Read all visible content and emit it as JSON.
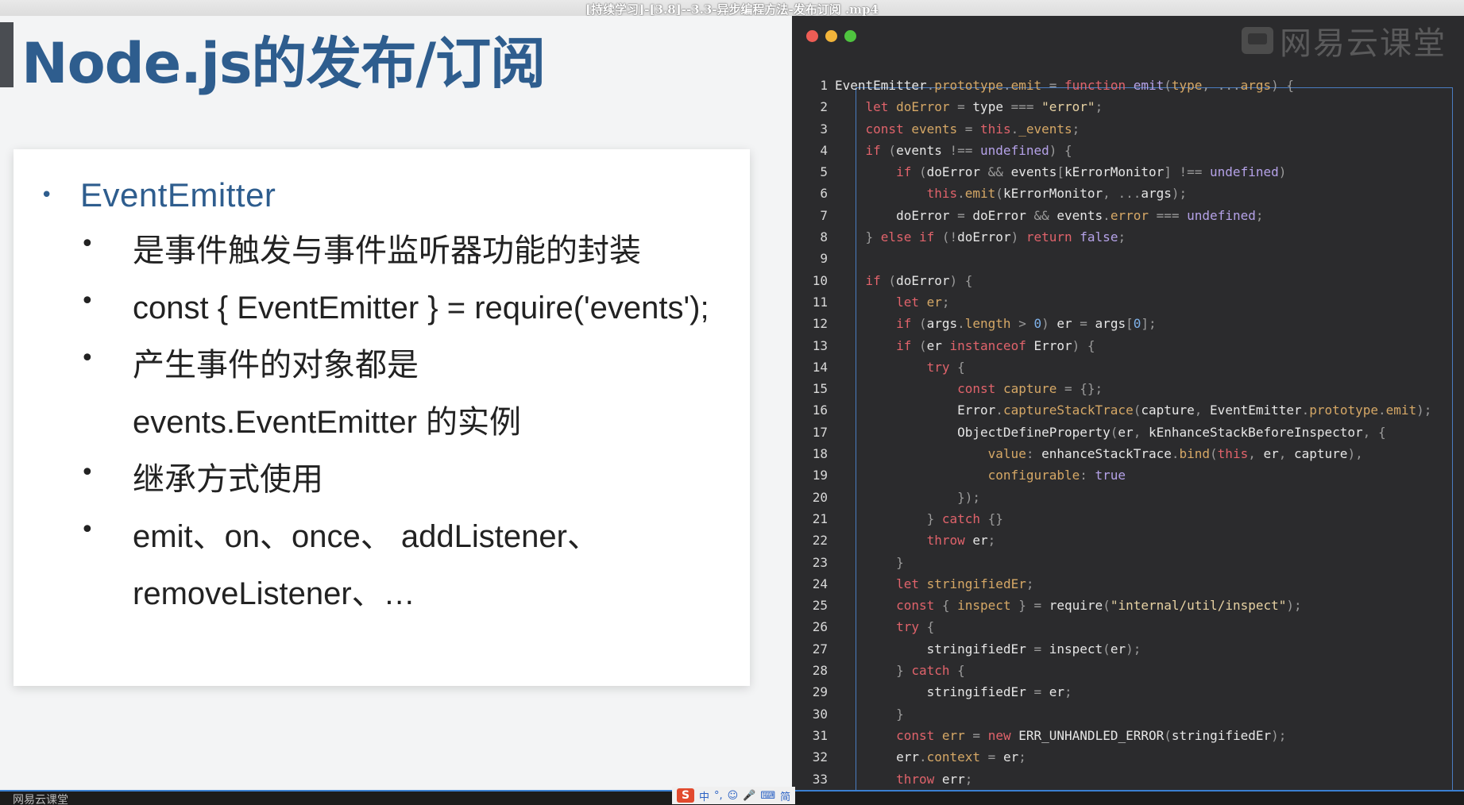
{
  "video": {
    "title": "[持续学习]-[3.8]--3.3-异步编程方法-发布订阅 .mp4"
  },
  "slide": {
    "title": "Node.js的发布/订阅",
    "heading": "EventEmitter",
    "bullets": [
      "是事件触发与事件监听器功能的封装",
      "const { EventEmitter } = require('events');",
      "产生事件的对象都是 events.EventEmitter 的实例",
      "继承方式使用",
      "emit、on、once、 addListener、 removeListener、…"
    ]
  },
  "code_panel": {
    "watermark": "网易云课堂",
    "lines": [
      [
        [
          "id",
          "EventEmitter"
        ],
        [
          "pun",
          "."
        ],
        [
          "prop",
          "prototype"
        ],
        [
          "pun",
          "."
        ],
        [
          "prop",
          "emit"
        ],
        [
          "pun",
          " = "
        ],
        [
          "kw",
          "function"
        ],
        [
          "pun",
          " "
        ],
        [
          "fn",
          "emit"
        ],
        [
          "pun",
          "("
        ],
        [
          "prop",
          "type"
        ],
        [
          "pun",
          ", "
        ],
        [
          "pun",
          "..."
        ],
        [
          "prop",
          "args"
        ],
        [
          "pun",
          ") {"
        ]
      ],
      [
        [
          "pun",
          "    "
        ],
        [
          "kw",
          "let"
        ],
        [
          "pun",
          " "
        ],
        [
          "prop",
          "doError"
        ],
        [
          "pun",
          " = "
        ],
        [
          "id",
          "type"
        ],
        [
          "pun",
          " === "
        ],
        [
          "str",
          "\"error\""
        ],
        [
          "pun",
          ";"
        ]
      ],
      [
        [
          "pun",
          "    "
        ],
        [
          "kw",
          "const"
        ],
        [
          "pun",
          " "
        ],
        [
          "prop",
          "events"
        ],
        [
          "pun",
          " = "
        ],
        [
          "kw",
          "this"
        ],
        [
          "pun",
          "."
        ],
        [
          "prop",
          "_events"
        ],
        [
          "pun",
          ";"
        ]
      ],
      [
        [
          "pun",
          "    "
        ],
        [
          "kw",
          "if"
        ],
        [
          "pun",
          " ("
        ],
        [
          "id",
          "events"
        ],
        [
          "pun",
          " !== "
        ],
        [
          "fn",
          "undefined"
        ],
        [
          "pun",
          ") {"
        ]
      ],
      [
        [
          "pun",
          "        "
        ],
        [
          "kw",
          "if"
        ],
        [
          "pun",
          " ("
        ],
        [
          "id",
          "doError"
        ],
        [
          "pun",
          " && "
        ],
        [
          "id",
          "events"
        ],
        [
          "pun",
          "["
        ],
        [
          "id",
          "kErrorMonitor"
        ],
        [
          "pun",
          "] !== "
        ],
        [
          "fn",
          "undefined"
        ],
        [
          "pun",
          ")"
        ]
      ],
      [
        [
          "pun",
          "            "
        ],
        [
          "kw",
          "this"
        ],
        [
          "pun",
          "."
        ],
        [
          "prop",
          "emit"
        ],
        [
          "pun",
          "("
        ],
        [
          "id",
          "kErrorMonitor"
        ],
        [
          "pun",
          ", "
        ],
        [
          "pun",
          "..."
        ],
        [
          "id",
          "args"
        ],
        [
          "pun",
          ");"
        ]
      ],
      [
        [
          "pun",
          "        "
        ],
        [
          "id",
          "doError"
        ],
        [
          "pun",
          " = "
        ],
        [
          "id",
          "doError"
        ],
        [
          "pun",
          " && "
        ],
        [
          "id",
          "events"
        ],
        [
          "pun",
          "."
        ],
        [
          "prop",
          "error"
        ],
        [
          "pun",
          " === "
        ],
        [
          "fn",
          "undefined"
        ],
        [
          "pun",
          ";"
        ]
      ],
      [
        [
          "pun",
          "    } "
        ],
        [
          "kw",
          "else if"
        ],
        [
          "pun",
          " (!"
        ],
        [
          "id",
          "doError"
        ],
        [
          "pun",
          ") "
        ],
        [
          "kw",
          "return"
        ],
        [
          "pun",
          " "
        ],
        [
          "fn",
          "false"
        ],
        [
          "pun",
          ";"
        ]
      ],
      [
        [
          "pun",
          ""
        ]
      ],
      [
        [
          "pun",
          "    "
        ],
        [
          "kw",
          "if"
        ],
        [
          "pun",
          " ("
        ],
        [
          "id",
          "doError"
        ],
        [
          "pun",
          ") {"
        ]
      ],
      [
        [
          "pun",
          "        "
        ],
        [
          "kw",
          "let"
        ],
        [
          "pun",
          " "
        ],
        [
          "prop",
          "er"
        ],
        [
          "pun",
          ";"
        ]
      ],
      [
        [
          "pun",
          "        "
        ],
        [
          "kw",
          "if"
        ],
        [
          "pun",
          " ("
        ],
        [
          "id",
          "args"
        ],
        [
          "pun",
          "."
        ],
        [
          "prop",
          "length"
        ],
        [
          "pun",
          " > "
        ],
        [
          "num",
          "0"
        ],
        [
          "pun",
          ") "
        ],
        [
          "id",
          "er"
        ],
        [
          "pun",
          " = "
        ],
        [
          "id",
          "args"
        ],
        [
          "pun",
          "["
        ],
        [
          "num",
          "0"
        ],
        [
          "pun",
          "];"
        ]
      ],
      [
        [
          "pun",
          "        "
        ],
        [
          "kw",
          "if"
        ],
        [
          "pun",
          " ("
        ],
        [
          "id",
          "er"
        ],
        [
          "pun",
          " "
        ],
        [
          "kw",
          "instanceof"
        ],
        [
          "pun",
          " "
        ],
        [
          "id",
          "Error"
        ],
        [
          "pun",
          ") {"
        ]
      ],
      [
        [
          "pun",
          "            "
        ],
        [
          "kw",
          "try"
        ],
        [
          "pun",
          " {"
        ]
      ],
      [
        [
          "pun",
          "                "
        ],
        [
          "kw",
          "const"
        ],
        [
          "pun",
          " "
        ],
        [
          "prop",
          "capture"
        ],
        [
          "pun",
          " = {};"
        ]
      ],
      [
        [
          "pun",
          "                "
        ],
        [
          "id",
          "Error"
        ],
        [
          "pun",
          "."
        ],
        [
          "prop",
          "captureStackTrace"
        ],
        [
          "pun",
          "("
        ],
        [
          "id",
          "capture"
        ],
        [
          "pun",
          ", "
        ],
        [
          "id",
          "EventEmitter"
        ],
        [
          "pun",
          "."
        ],
        [
          "prop",
          "prototype"
        ],
        [
          "pun",
          "."
        ],
        [
          "prop",
          "emit"
        ],
        [
          "pun",
          ");"
        ]
      ],
      [
        [
          "pun",
          "                "
        ],
        [
          "id",
          "ObjectDefineProperty"
        ],
        [
          "pun",
          "("
        ],
        [
          "id",
          "er"
        ],
        [
          "pun",
          ", "
        ],
        [
          "id",
          "kEnhanceStackBeforeInspector"
        ],
        [
          "pun",
          ", {"
        ]
      ],
      [
        [
          "pun",
          "                    "
        ],
        [
          "prop",
          "value"
        ],
        [
          "pun",
          ": "
        ],
        [
          "id",
          "enhanceStackTrace"
        ],
        [
          "pun",
          "."
        ],
        [
          "prop",
          "bind"
        ],
        [
          "pun",
          "("
        ],
        [
          "kw",
          "this"
        ],
        [
          "pun",
          ", "
        ],
        [
          "id",
          "er"
        ],
        [
          "pun",
          ", "
        ],
        [
          "id",
          "capture"
        ],
        [
          "pun",
          "),"
        ]
      ],
      [
        [
          "pun",
          "                    "
        ],
        [
          "prop",
          "configurable"
        ],
        [
          "pun",
          ": "
        ],
        [
          "fn",
          "true"
        ]
      ],
      [
        [
          "pun",
          "                });"
        ]
      ],
      [
        [
          "pun",
          "            } "
        ],
        [
          "kw",
          "catch"
        ],
        [
          "pun",
          " {}"
        ]
      ],
      [
        [
          "pun",
          "            "
        ],
        [
          "kw",
          "throw"
        ],
        [
          "pun",
          " "
        ],
        [
          "id",
          "er"
        ],
        [
          "pun",
          ";"
        ]
      ],
      [
        [
          "pun",
          "        }"
        ]
      ],
      [
        [
          "pun",
          "        "
        ],
        [
          "kw",
          "let"
        ],
        [
          "pun",
          " "
        ],
        [
          "prop",
          "stringifiedEr"
        ],
        [
          "pun",
          ";"
        ]
      ],
      [
        [
          "pun",
          "        "
        ],
        [
          "kw",
          "const"
        ],
        [
          "pun",
          " { "
        ],
        [
          "prop",
          "inspect"
        ],
        [
          "pun",
          " } = "
        ],
        [
          "id",
          "require"
        ],
        [
          "pun",
          "("
        ],
        [
          "str",
          "\"internal/util/inspect\""
        ],
        [
          "pun",
          ");"
        ]
      ],
      [
        [
          "pun",
          "        "
        ],
        [
          "kw",
          "try"
        ],
        [
          "pun",
          " {"
        ]
      ],
      [
        [
          "pun",
          "            "
        ],
        [
          "id",
          "stringifiedEr"
        ],
        [
          "pun",
          " = "
        ],
        [
          "id",
          "inspect"
        ],
        [
          "pun",
          "("
        ],
        [
          "id",
          "er"
        ],
        [
          "pun",
          ");"
        ]
      ],
      [
        [
          "pun",
          "        } "
        ],
        [
          "kw",
          "catch"
        ],
        [
          "pun",
          " {"
        ]
      ],
      [
        [
          "pun",
          "            "
        ],
        [
          "id",
          "stringifiedEr"
        ],
        [
          "pun",
          " = "
        ],
        [
          "id",
          "er"
        ],
        [
          "pun",
          ";"
        ]
      ],
      [
        [
          "pun",
          "        }"
        ]
      ],
      [
        [
          "pun",
          "        "
        ],
        [
          "kw",
          "const"
        ],
        [
          "pun",
          " "
        ],
        [
          "prop",
          "err"
        ],
        [
          "pun",
          " = "
        ],
        [
          "kw",
          "new"
        ],
        [
          "pun",
          " "
        ],
        [
          "id",
          "ERR_UNHANDLED_ERROR"
        ],
        [
          "pun",
          "("
        ],
        [
          "id",
          "stringifiedEr"
        ],
        [
          "pun",
          ");"
        ]
      ],
      [
        [
          "pun",
          "        "
        ],
        [
          "id",
          "err"
        ],
        [
          "pun",
          "."
        ],
        [
          "prop",
          "context"
        ],
        [
          "pun",
          " = "
        ],
        [
          "id",
          "er"
        ],
        [
          "pun",
          ";"
        ]
      ],
      [
        [
          "pun",
          "        "
        ],
        [
          "kw",
          "throw"
        ],
        [
          "pun",
          " "
        ],
        [
          "id",
          "err"
        ],
        [
          "pun",
          ";"
        ]
      ]
    ]
  },
  "taskbar": {
    "left_text": "网易云课堂",
    "ime_label": "S",
    "ime_items": [
      "中",
      "°,",
      "☺",
      "🎤",
      "⌨",
      "简"
    ]
  },
  "colors": {
    "title_blue": "#2e5d8e",
    "panel_bg": "#2b2b2d",
    "keyword": "#e0636b",
    "guide_border": "#4a7cc0"
  }
}
